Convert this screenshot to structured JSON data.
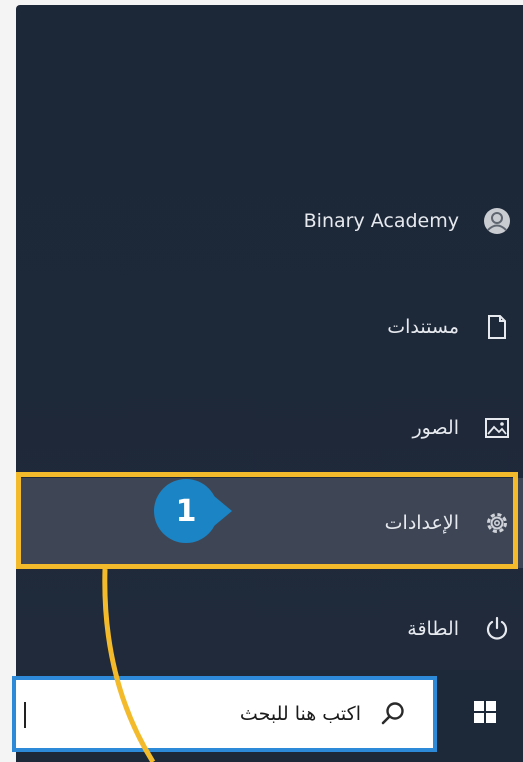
{
  "start_menu": {
    "user": {
      "name": "Binary Academy",
      "icon": "avatar-icon"
    },
    "items": [
      {
        "id": "documents",
        "label": "مستندات",
        "icon": "document-icon"
      },
      {
        "id": "pictures",
        "label": "الصور",
        "icon": "picture-icon"
      },
      {
        "id": "settings",
        "label": "الإعدادات",
        "icon": "gear-icon"
      },
      {
        "id": "power",
        "label": "الطاقة",
        "icon": "power-icon"
      }
    ]
  },
  "annotation": {
    "step_number": "1",
    "highlight_color": "#f3bb2c",
    "badge_color": "#1b84c5"
  },
  "taskbar": {
    "search_placeholder": "اكتب هنا للبحث",
    "search_icon": "search-icon",
    "start_icon": "windows-logo-icon"
  },
  "colors": {
    "menu_background": "#1d2839",
    "selected_item_background": "#3e4655",
    "menu_text": "#e6e9ee",
    "search_border": "#2c8ad8"
  }
}
